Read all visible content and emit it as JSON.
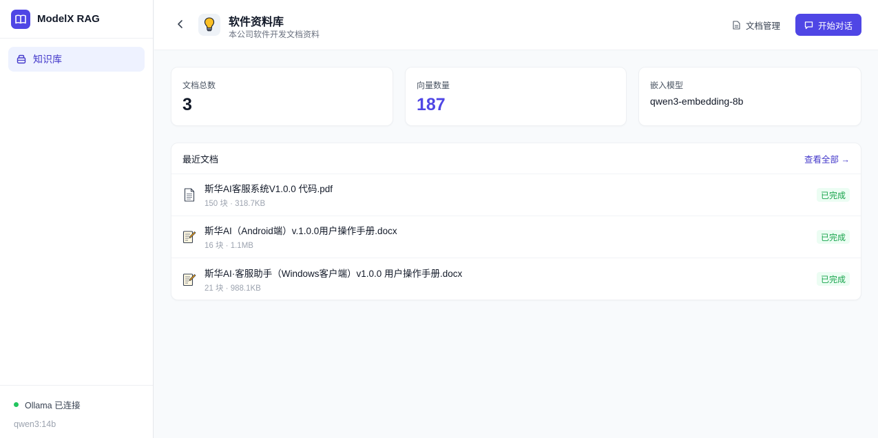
{
  "app": {
    "name": "ModelX RAG",
    "brand_color": "#4f46e5"
  },
  "sidebar": {
    "items": [
      {
        "label": "知识库",
        "icon": "database-icon",
        "active": true
      }
    ],
    "footer": {
      "status": "Ollama 已连接",
      "status_color": "#22c55e",
      "model": "qwen3:14b"
    }
  },
  "header": {
    "title": "软件资料库",
    "description": "本公司软件开发文档资料",
    "icon": "lightbulb-icon",
    "doc_manage_label": "文档管理",
    "chat_label": "开始对话"
  },
  "stats": {
    "doc_count_label": "文档总数",
    "doc_count": "3",
    "vector_count_label": "向量数量",
    "vector_count": "187",
    "embed_model_label": "嵌入模型",
    "embed_model": "qwen3-embedding-8b"
  },
  "recent": {
    "title": "最近文档",
    "view_all": "查看全部 →",
    "docs": [
      {
        "name": "斯华AI客服系统V1.0.0 代码.pdf",
        "meta": "150 块 · 318.7KB",
        "status": "已完成",
        "icon": "pdf-file-icon"
      },
      {
        "name": "斯华AI（Android端）v.1.0.0用户操作手册.docx",
        "meta": "16 块 · 1.1MB",
        "status": "已完成",
        "icon": "memo-file-icon"
      },
      {
        "name": "斯华AI·客服助手（Windows客户端）v1.0.0 用户操作手册.docx",
        "meta": "21 块 · 988.1KB",
        "status": "已完成",
        "icon": "memo-file-icon"
      }
    ]
  }
}
